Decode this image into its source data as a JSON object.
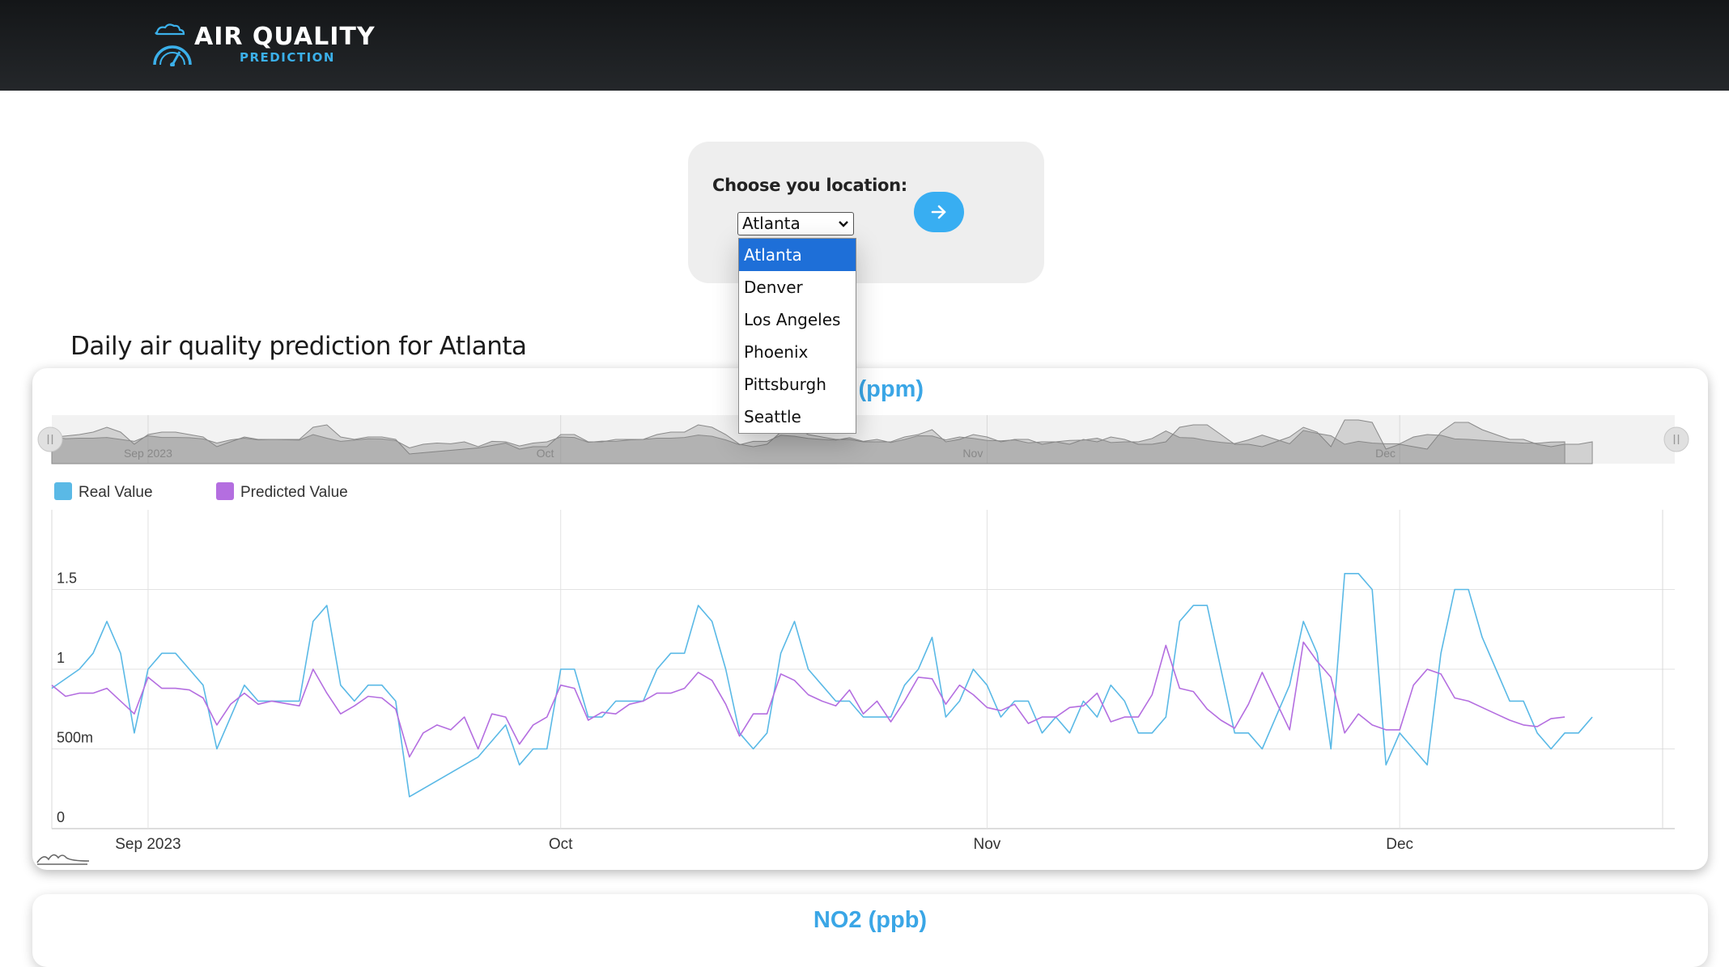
{
  "header": {
    "logo_title": "AIR QUALITY",
    "logo_subtitle": "PREDICTION",
    "logo_icon": "cloud-gauge-icon"
  },
  "location": {
    "label": "Choose you location:",
    "selected": "Atlanta",
    "options": [
      "Atlanta",
      "Denver",
      "Los Angeles",
      "Phoenix",
      "Pittsburgh",
      "Seattle"
    ],
    "go_icon": "arrow-right-icon"
  },
  "page_title": "Daily air quality prediction for Atlanta",
  "charts": [
    {
      "title": "CO (ppm)"
    },
    {
      "title": "NO2 (ppb)"
    }
  ],
  "colors": {
    "real": "#5ab9e6",
    "predicted": "#b46ee0",
    "title": "#3aa6e6",
    "button": "#38aef2"
  },
  "chart_data": {
    "type": "line",
    "title": "CO (ppm)",
    "x_range": [
      "2023-08-25",
      "2023-12-21"
    ],
    "x_ticks": [
      {
        "date": "2023-09-01",
        "label": "Sep 2023"
      },
      {
        "date": "2023-10-01",
        "label": "Oct"
      },
      {
        "date": "2023-11-01",
        "label": "Nov"
      },
      {
        "date": "2023-12-01",
        "label": "Dec"
      }
    ],
    "ylim": [
      0,
      2
    ],
    "y_ticks": [
      {
        "value": 0,
        "label": "0"
      },
      {
        "value": 0.5,
        "label": "500m"
      },
      {
        "value": 1,
        "label": "1"
      },
      {
        "value": 1.5,
        "label": "1.5"
      }
    ],
    "legend_position": "top-left",
    "navigator": true,
    "series": [
      {
        "name": "Real Value",
        "points": [
          [
            "2023-08-25",
            0.88
          ],
          [
            "2023-08-27",
            1.0
          ],
          [
            "2023-08-28",
            1.1
          ],
          [
            "2023-08-29",
            1.3
          ],
          [
            "2023-08-30",
            1.1
          ],
          [
            "2023-08-31",
            0.6
          ],
          [
            "2023-09-01",
            1.0
          ],
          [
            "2023-09-02",
            1.1
          ],
          [
            "2023-09-03",
            1.1
          ],
          [
            "2023-09-04",
            1.0
          ],
          [
            "2023-09-05",
            0.9
          ],
          [
            "2023-09-06",
            0.5
          ],
          [
            "2023-09-07",
            0.7
          ],
          [
            "2023-09-08",
            0.9
          ],
          [
            "2023-09-09",
            0.8
          ],
          [
            "2023-09-10",
            0.8
          ],
          [
            "2023-09-12",
            0.8
          ],
          [
            "2023-09-13",
            1.3
          ],
          [
            "2023-09-14",
            1.4
          ],
          [
            "2023-09-15",
            0.9
          ],
          [
            "2023-09-16",
            0.8
          ],
          [
            "2023-09-17",
            0.9
          ],
          [
            "2023-09-18",
            0.9
          ],
          [
            "2023-09-19",
            0.8
          ],
          [
            "2023-09-20",
            0.2
          ],
          [
            "2023-09-25",
            0.45
          ],
          [
            "2023-09-26",
            0.55
          ],
          [
            "2023-09-27",
            0.65
          ],
          [
            "2023-09-28",
            0.4
          ],
          [
            "2023-09-29",
            0.5
          ],
          [
            "2023-09-30",
            0.5
          ],
          [
            "2023-10-01",
            1.0
          ],
          [
            "2023-10-02",
            1.0
          ],
          [
            "2023-10-03",
            0.7
          ],
          [
            "2023-10-04",
            0.7
          ],
          [
            "2023-10-05",
            0.8
          ],
          [
            "2023-10-06",
            0.8
          ],
          [
            "2023-10-07",
            0.8
          ],
          [
            "2023-10-08",
            1.0
          ],
          [
            "2023-10-09",
            1.1
          ],
          [
            "2023-10-10",
            1.1
          ],
          [
            "2023-10-11",
            1.4
          ],
          [
            "2023-10-12",
            1.3
          ],
          [
            "2023-10-13",
            1.0
          ],
          [
            "2023-10-14",
            0.6
          ],
          [
            "2023-10-15",
            0.5
          ],
          [
            "2023-10-16",
            0.6
          ],
          [
            "2023-10-17",
            1.1
          ],
          [
            "2023-10-18",
            1.3
          ],
          [
            "2023-10-19",
            1.0
          ],
          [
            "2023-10-20",
            0.9
          ],
          [
            "2023-10-21",
            0.8
          ],
          [
            "2023-10-22",
            0.8
          ],
          [
            "2023-10-23",
            0.7
          ],
          [
            "2023-10-24",
            0.7
          ],
          [
            "2023-10-25",
            0.7
          ],
          [
            "2023-10-26",
            0.9
          ],
          [
            "2023-10-27",
            1.0
          ],
          [
            "2023-10-28",
            1.2
          ],
          [
            "2023-10-29",
            0.7
          ],
          [
            "2023-10-30",
            0.8
          ],
          [
            "2023-10-31",
            1.0
          ],
          [
            "2023-11-01",
            0.9
          ],
          [
            "2023-11-02",
            0.7
          ],
          [
            "2023-11-03",
            0.8
          ],
          [
            "2023-11-04",
            0.8
          ],
          [
            "2023-11-05",
            0.6
          ],
          [
            "2023-11-06",
            0.7
          ],
          [
            "2023-11-07",
            0.6
          ],
          [
            "2023-11-08",
            0.8
          ],
          [
            "2023-11-09",
            0.7
          ],
          [
            "2023-11-10",
            0.9
          ],
          [
            "2023-11-11",
            0.8
          ],
          [
            "2023-11-12",
            0.6
          ],
          [
            "2023-11-13",
            0.6
          ],
          [
            "2023-11-14",
            0.7
          ],
          [
            "2023-11-15",
            1.3
          ],
          [
            "2023-11-16",
            1.4
          ],
          [
            "2023-11-17",
            1.4
          ],
          [
            "2023-11-18",
            1.0
          ],
          [
            "2023-11-19",
            0.6
          ],
          [
            "2023-11-20",
            0.6
          ],
          [
            "2023-11-21",
            0.5
          ],
          [
            "2023-11-22",
            0.7
          ],
          [
            "2023-11-23",
            0.9
          ],
          [
            "2023-11-24",
            1.3
          ],
          [
            "2023-11-25",
            1.1
          ],
          [
            "2023-11-26",
            0.5
          ],
          [
            "2023-11-27",
            1.6
          ],
          [
            "2023-11-28",
            1.6
          ],
          [
            "2023-11-29",
            1.5
          ],
          [
            "2023-11-30",
            0.4
          ],
          [
            "2023-12-01",
            0.6
          ],
          [
            "2023-12-02",
            0.5
          ],
          [
            "2023-12-03",
            0.4
          ],
          [
            "2023-12-04",
            1.1
          ],
          [
            "2023-12-05",
            1.5
          ],
          [
            "2023-12-06",
            1.5
          ],
          [
            "2023-12-07",
            1.2
          ],
          [
            "2023-12-08",
            1.0
          ],
          [
            "2023-12-09",
            0.8
          ],
          [
            "2023-12-10",
            0.8
          ],
          [
            "2023-12-11",
            0.6
          ],
          [
            "2023-12-12",
            0.5
          ],
          [
            "2023-12-13",
            0.6
          ],
          [
            "2023-12-14",
            0.6
          ],
          [
            "2023-12-15",
            0.7
          ]
        ]
      },
      {
        "name": "Predicted Value",
        "points": [
          [
            "2023-08-25",
            0.9
          ],
          [
            "2023-08-26",
            0.83
          ],
          [
            "2023-08-27",
            0.85
          ],
          [
            "2023-08-28",
            0.85
          ],
          [
            "2023-08-29",
            0.88
          ],
          [
            "2023-08-30",
            0.8
          ],
          [
            "2023-08-31",
            0.72
          ],
          [
            "2023-09-01",
            0.95
          ],
          [
            "2023-09-02",
            0.88
          ],
          [
            "2023-09-03",
            0.88
          ],
          [
            "2023-09-04",
            0.87
          ],
          [
            "2023-09-05",
            0.82
          ],
          [
            "2023-09-06",
            0.65
          ],
          [
            "2023-09-07",
            0.78
          ],
          [
            "2023-09-08",
            0.85
          ],
          [
            "2023-09-09",
            0.78
          ],
          [
            "2023-09-10",
            0.8
          ],
          [
            "2023-09-12",
            0.77
          ],
          [
            "2023-09-13",
            1.0
          ],
          [
            "2023-09-14",
            0.85
          ],
          [
            "2023-09-15",
            0.72
          ],
          [
            "2023-09-16",
            0.77
          ],
          [
            "2023-09-17",
            0.83
          ],
          [
            "2023-09-18",
            0.82
          ],
          [
            "2023-09-19",
            0.75
          ],
          [
            "2023-09-20",
            0.45
          ],
          [
            "2023-09-21",
            0.6
          ],
          [
            "2023-09-22",
            0.65
          ],
          [
            "2023-09-23",
            0.62
          ],
          [
            "2023-09-24",
            0.7
          ],
          [
            "2023-09-25",
            0.5
          ],
          [
            "2023-09-26",
            0.72
          ],
          [
            "2023-09-27",
            0.7
          ],
          [
            "2023-09-28",
            0.53
          ],
          [
            "2023-09-29",
            0.65
          ],
          [
            "2023-09-30",
            0.7
          ],
          [
            "2023-10-01",
            0.9
          ],
          [
            "2023-10-02",
            0.88
          ],
          [
            "2023-10-03",
            0.68
          ],
          [
            "2023-10-04",
            0.73
          ],
          [
            "2023-10-05",
            0.72
          ],
          [
            "2023-10-06",
            0.78
          ],
          [
            "2023-10-07",
            0.8
          ],
          [
            "2023-10-08",
            0.85
          ],
          [
            "2023-10-09",
            0.85
          ],
          [
            "2023-10-10",
            0.88
          ],
          [
            "2023-10-11",
            0.98
          ],
          [
            "2023-10-12",
            0.93
          ],
          [
            "2023-10-13",
            0.78
          ],
          [
            "2023-10-14",
            0.58
          ],
          [
            "2023-10-15",
            0.72
          ],
          [
            "2023-10-16",
            0.72
          ],
          [
            "2023-10-17",
            0.97
          ],
          [
            "2023-10-18",
            0.93
          ],
          [
            "2023-10-19",
            0.84
          ],
          [
            "2023-10-20",
            0.8
          ],
          [
            "2023-10-21",
            0.77
          ],
          [
            "2023-10-22",
            0.87
          ],
          [
            "2023-10-23",
            0.72
          ],
          [
            "2023-10-24",
            0.8
          ],
          [
            "2023-10-25",
            0.67
          ],
          [
            "2023-10-26",
            0.8
          ],
          [
            "2023-10-27",
            0.95
          ],
          [
            "2023-10-28",
            0.94
          ],
          [
            "2023-10-29",
            0.78
          ],
          [
            "2023-10-30",
            0.9
          ],
          [
            "2023-10-31",
            0.84
          ],
          [
            "2023-11-01",
            0.76
          ],
          [
            "2023-11-02",
            0.74
          ],
          [
            "2023-11-03",
            0.78
          ],
          [
            "2023-11-04",
            0.66
          ],
          [
            "2023-11-05",
            0.7
          ],
          [
            "2023-11-06",
            0.7
          ],
          [
            "2023-11-07",
            0.76
          ],
          [
            "2023-11-08",
            0.77
          ],
          [
            "2023-11-09",
            0.85
          ],
          [
            "2023-11-10",
            0.67
          ],
          [
            "2023-11-11",
            0.7
          ],
          [
            "2023-11-12",
            0.7
          ],
          [
            "2023-11-13",
            0.84
          ],
          [
            "2023-11-14",
            1.15
          ],
          [
            "2023-11-15",
            0.88
          ],
          [
            "2023-11-16",
            0.86
          ],
          [
            "2023-11-17",
            0.75
          ],
          [
            "2023-11-18",
            0.68
          ],
          [
            "2023-11-19",
            0.63
          ],
          [
            "2023-11-20",
            0.78
          ],
          [
            "2023-11-21",
            0.98
          ],
          [
            "2023-11-22",
            0.8
          ],
          [
            "2023-11-23",
            0.62
          ],
          [
            "2023-11-24",
            1.17
          ],
          [
            "2023-11-25",
            1.05
          ],
          [
            "2023-11-26",
            0.95
          ],
          [
            "2023-11-27",
            0.6
          ],
          [
            "2023-11-28",
            0.72
          ],
          [
            "2023-11-29",
            0.65
          ],
          [
            "2023-11-30",
            0.62
          ],
          [
            "2023-12-01",
            0.62
          ],
          [
            "2023-12-02",
            0.9
          ],
          [
            "2023-12-03",
            1.0
          ],
          [
            "2023-12-04",
            0.97
          ],
          [
            "2023-12-05",
            0.82
          ],
          [
            "2023-12-06",
            0.8
          ],
          [
            "2023-12-07",
            0.76
          ],
          [
            "2023-12-08",
            0.72
          ],
          [
            "2023-12-09",
            0.68
          ],
          [
            "2023-12-10",
            0.65
          ],
          [
            "2023-12-11",
            0.64
          ],
          [
            "2023-12-12",
            0.69
          ],
          [
            "2023-12-13",
            0.7
          ]
        ]
      }
    ]
  }
}
